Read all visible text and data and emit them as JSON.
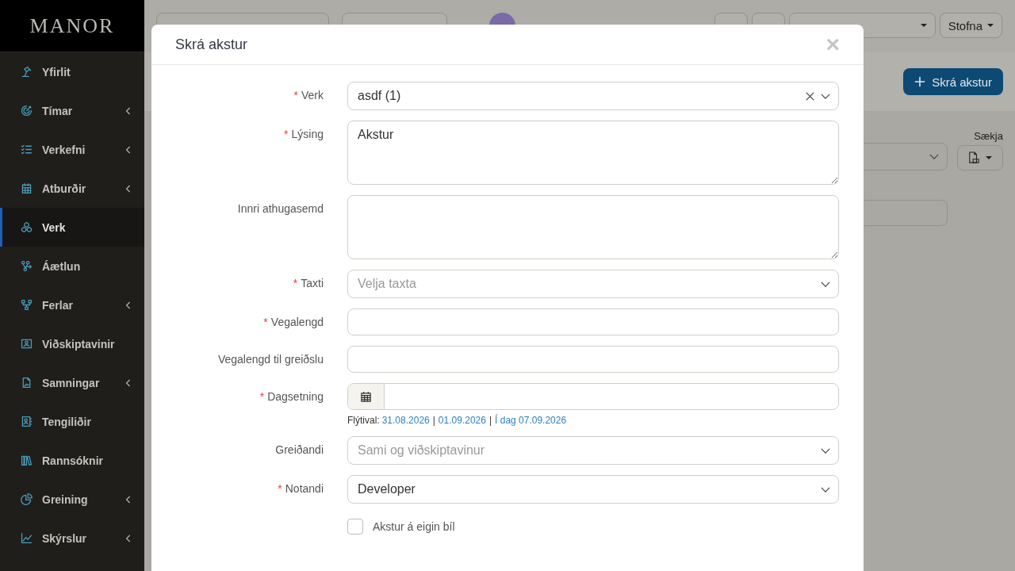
{
  "app": {
    "logo": "MANOR"
  },
  "sidebar": {
    "items": [
      {
        "label": "Yfirlit",
        "selected": false,
        "expandable": false
      },
      {
        "label": "Tímar",
        "selected": false,
        "expandable": true
      },
      {
        "label": "Verkefni",
        "selected": false,
        "expandable": true
      },
      {
        "label": "Atburðir",
        "selected": false,
        "expandable": true
      },
      {
        "label": "Verk",
        "selected": true,
        "expandable": false
      },
      {
        "label": "Áætlun",
        "selected": false,
        "expandable": false
      },
      {
        "label": "Ferlar",
        "selected": false,
        "expandable": true
      },
      {
        "label": "Viðskiptavinir",
        "selected": false,
        "expandable": false
      },
      {
        "label": "Samningar",
        "selected": false,
        "expandable": true
      },
      {
        "label": "Tengiliðir",
        "selected": false,
        "expandable": false
      },
      {
        "label": "Rannsóknir",
        "selected": false,
        "expandable": false
      },
      {
        "label": "Greining",
        "selected": false,
        "expandable": true
      },
      {
        "label": "Skýrslur",
        "selected": false,
        "expandable": true
      }
    ]
  },
  "topbar": {
    "create_button": "Stofna"
  },
  "toolbar": {
    "add_button": "Skrá akstur"
  },
  "content": {
    "download_label": "Sækja"
  },
  "modal": {
    "title": "Skrá akstur",
    "close": "×",
    "required_mark": "*",
    "fields": [
      {
        "kind": "select",
        "label": "Verk",
        "required": true,
        "value": "asdf (1)",
        "clearable": true
      },
      {
        "kind": "textarea",
        "label": "Lýsing",
        "required": true,
        "value": "Akstur"
      },
      {
        "kind": "textarea",
        "label": "Innri athugasemd",
        "required": false
      },
      {
        "kind": "select",
        "label": "Taxti",
        "required": true,
        "placeholder": "Velja taxta",
        "clearable": false
      },
      {
        "kind": "text",
        "label": "Vegalengd",
        "required": true
      },
      {
        "kind": "text",
        "label": "Vegalengd til greiðslu",
        "required": false
      },
      {
        "kind": "date",
        "label": "Dagsetning",
        "required": true,
        "hint": {
          "label": "Flýtival:",
          "separator": "|",
          "links": [
            "31.08.2026",
            "01.09.2026",
            "Í dag 07.09.2026"
          ]
        }
      },
      {
        "kind": "select",
        "label": "Greiðandi",
        "required": false,
        "placeholder": "Sami og viðskiptavinur",
        "clearable": false
      },
      {
        "kind": "select",
        "label": "Notandi",
        "required": true,
        "value": "Developer",
        "clearable": false
      },
      {
        "kind": "checkbox",
        "label": "Akstur á eigin bíl",
        "checked": false
      }
    ]
  }
}
